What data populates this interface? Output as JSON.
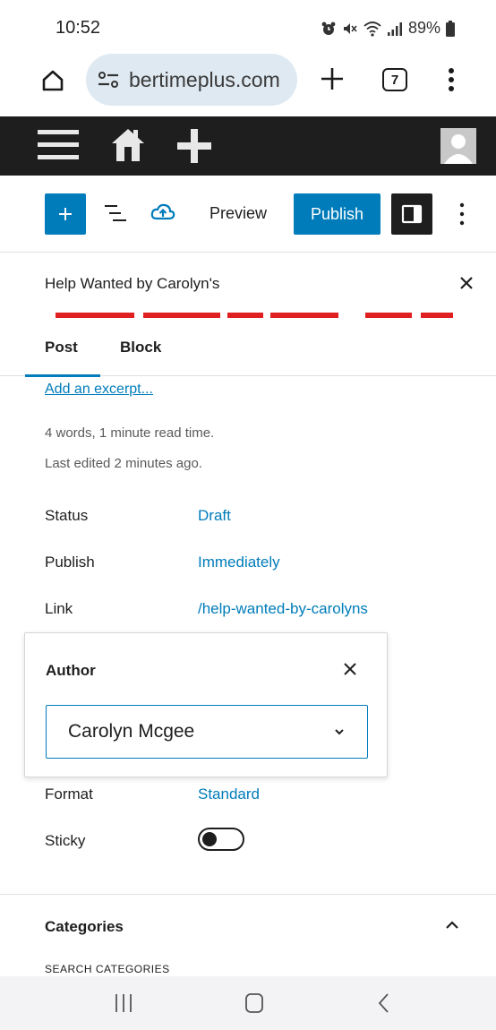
{
  "status_bar": {
    "time": "10:52",
    "battery": "89%",
    "icons": [
      "alarm-icon",
      "mute-icon",
      "wifi-icon",
      "signal-icon",
      "battery-icon"
    ]
  },
  "browser": {
    "url": "bertimeplus.com",
    "tab_count": "7",
    "icons": [
      "home-icon",
      "site-settings-icon",
      "new-tab-icon",
      "tabs-icon",
      "overflow-menu-icon"
    ]
  },
  "admin_bar": {
    "icons": [
      "menu-icon",
      "house-icon",
      "add-new-icon",
      "avatar-icon"
    ]
  },
  "toolbar": {
    "preview_label": "Preview",
    "publish_label": "Publish",
    "accent": "#007cba",
    "icons": [
      "block-inserter-icon",
      "document-outline-icon",
      "cloud-upload-icon",
      "settings-sidebar-icon",
      "options-icon"
    ]
  },
  "panel": {
    "title": "Help Wanted by Carolyn's",
    "tabs": [
      "Post",
      "Block"
    ]
  },
  "summary": {
    "excerpt_link": "Add an excerpt...",
    "word_count": "4 words, 1 minute read time.",
    "last_edited": "Last edited 2 minutes ago."
  },
  "fields": [
    {
      "label": "Status",
      "value": "Draft"
    },
    {
      "label": "Publish",
      "value": "Immediately"
    },
    {
      "label": "Link",
      "value": "/help-wanted-by-carolyns"
    },
    {
      "label": "Format",
      "value": "Standard"
    },
    {
      "label": "Sticky",
      "value": ""
    }
  ],
  "author_popover": {
    "title": "Author",
    "selected": "Carolyn Mcgee"
  },
  "sticky": {
    "on": false
  },
  "categories": {
    "title": "Categories",
    "search_label": "SEARCH CATEGORIES"
  },
  "android_nav": {
    "icons": [
      "recent-apps-icon",
      "home-button-icon",
      "back-icon"
    ]
  }
}
